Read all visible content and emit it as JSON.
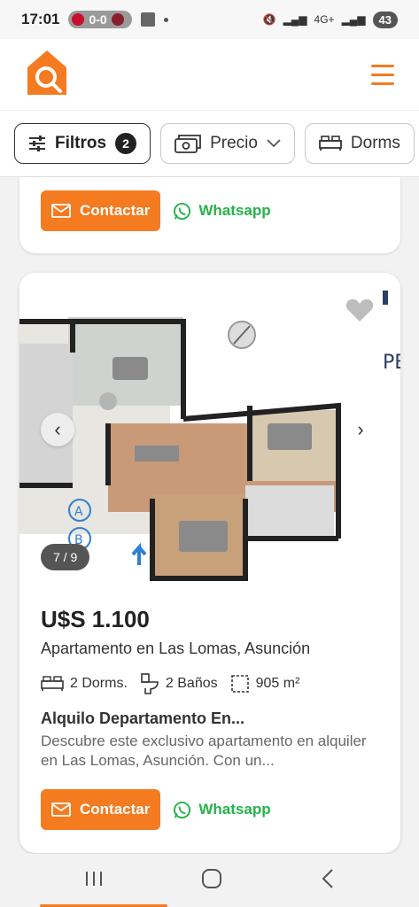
{
  "status_bar": {
    "time": "17:01",
    "score": "0-0",
    "battery": "43",
    "network": "4G+"
  },
  "header": {
    "logo_icon": "house-search-icon",
    "menu_icon": "hamburger-menu-icon"
  },
  "filters": [
    {
      "label": "Filtros",
      "badge": "2",
      "icon": "sliders-icon"
    },
    {
      "label": "Precio",
      "icon": "money-icon"
    },
    {
      "label": "Dorms",
      "icon": "bed-icon"
    }
  ],
  "actions": {
    "contact_label": "Contactar",
    "whatsapp_label": "Whatsapp"
  },
  "listing": {
    "image_counter": "7 / 9",
    "price": "U$S 1.100",
    "location": "Apartamento en Las Lomas, Asunción",
    "bedrooms": "2 Dorms.",
    "bathrooms": "2 Baños",
    "area": "905 m²",
    "title": "Alquilo Departamento En...",
    "description": "Descubre este exclusivo apartamento en alquiler en Las Lomas, Asunción. Con un..."
  },
  "colors": {
    "brand": "#f47b20",
    "whatsapp": "#25b24a"
  }
}
